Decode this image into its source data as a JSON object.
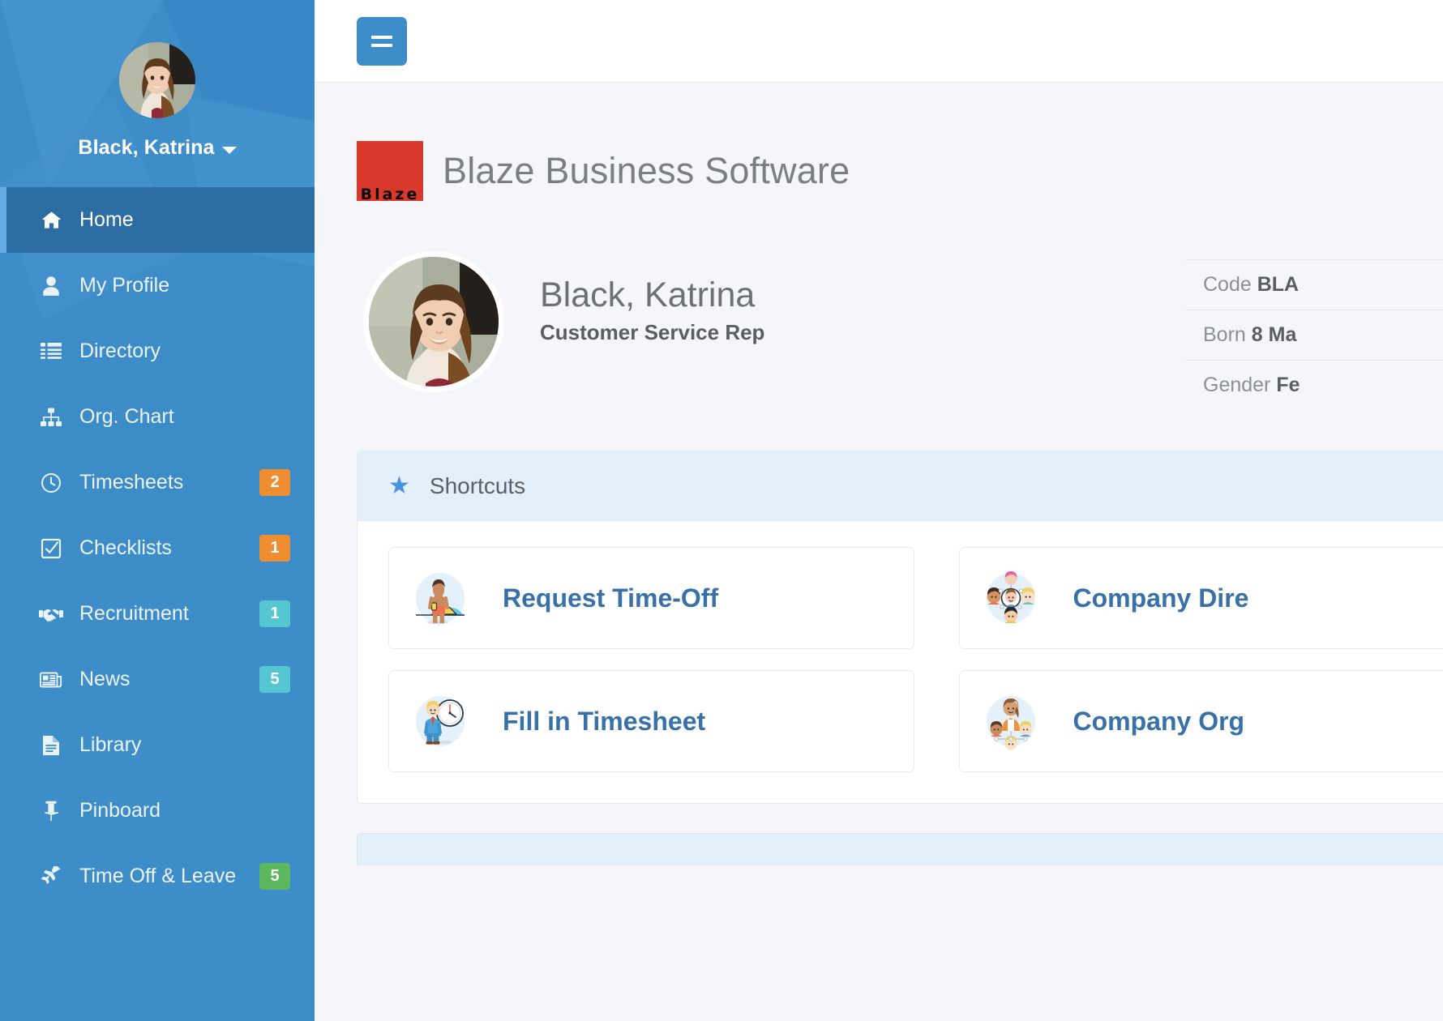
{
  "sidebar": {
    "user": {
      "name": "Black, Katrina",
      "avatar_alt": "user-photo"
    },
    "items": [
      {
        "label": "Home",
        "icon": "home-icon",
        "badge": null,
        "badge_color": null,
        "active": true
      },
      {
        "label": "My Profile",
        "icon": "user-icon",
        "badge": null,
        "badge_color": null,
        "active": false
      },
      {
        "label": "Directory",
        "icon": "list-icon",
        "badge": null,
        "badge_color": null,
        "active": false
      },
      {
        "label": "Org. Chart",
        "icon": "sitemap-icon",
        "badge": null,
        "badge_color": null,
        "active": false
      },
      {
        "label": "Timesheets",
        "icon": "clock-icon",
        "badge": "2",
        "badge_color": "#ef8e31",
        "active": false
      },
      {
        "label": "Checklists",
        "icon": "check-square-icon",
        "badge": "1",
        "badge_color": "#ef8e31",
        "active": false
      },
      {
        "label": "Recruitment",
        "icon": "handshake-icon",
        "badge": "1",
        "badge_color": "#56c6d2",
        "active": false
      },
      {
        "label": "News",
        "icon": "newspaper-icon",
        "badge": "5",
        "badge_color": "#56c6d2",
        "active": false
      },
      {
        "label": "Library",
        "icon": "document-icon",
        "badge": null,
        "badge_color": null,
        "active": false
      },
      {
        "label": "Pinboard",
        "icon": "pin-icon",
        "badge": null,
        "badge_color": null,
        "active": false
      },
      {
        "label": "Time Off & Leave",
        "icon": "plane-icon",
        "badge": "5",
        "badge_color": "#5cb85c",
        "active": false
      }
    ]
  },
  "topbar": {
    "menu_icon": "hamburger-icon"
  },
  "brand": {
    "logo_text": "Blaze",
    "title": "Blaze Business Software"
  },
  "profile": {
    "name": "Black, Katrina",
    "role": "Customer Service Rep",
    "info": [
      {
        "label": "Code",
        "value": "BLA"
      },
      {
        "label": "Born",
        "value": "8 Ma"
      },
      {
        "label": "Gender",
        "value": "Fe"
      }
    ]
  },
  "shortcuts": {
    "title": "Shortcuts",
    "icon": "star-icon",
    "cards": [
      {
        "label": "Request Time-Off",
        "icon": "surfer-illustration"
      },
      {
        "label": "Company Dire",
        "icon": "people-network-illustration"
      },
      {
        "label": "Fill in Timesheet",
        "icon": "businessman-clock-illustration"
      },
      {
        "label": "Company Org",
        "icon": "org-chart-people-illustration"
      }
    ]
  },
  "colors": {
    "sidebar": "#3d8dc9",
    "sidebar_active": "#2c6da4",
    "accent": "#4a93e0",
    "link": "#3871a8",
    "brand_red": "#d8392b",
    "panel_head": "#e3eff9",
    "page_bg": "#f4f6f9"
  }
}
